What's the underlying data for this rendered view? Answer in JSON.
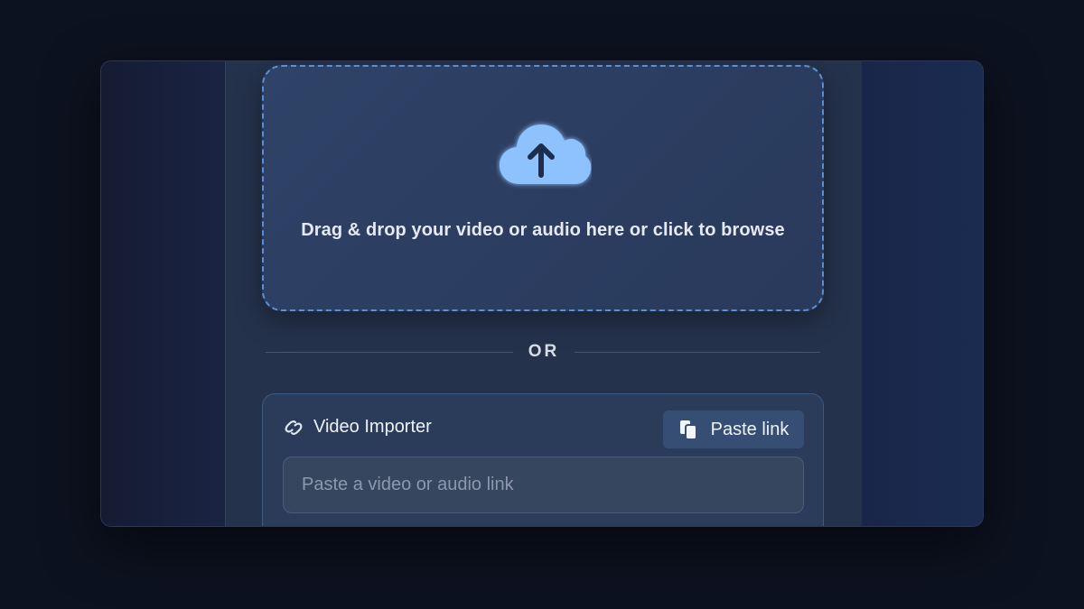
{
  "dropzone": {
    "icon": "cloud-upload-icon",
    "text": "Drag & drop your video or audio here or click to browse",
    "accent": "#5c8fd0",
    "icon_color": "#8ec2ff"
  },
  "divider": {
    "label": "OR"
  },
  "importer": {
    "icon": "link-icon",
    "title": "Video Importer",
    "paste_button": {
      "icon": "clipboard-icon",
      "label": "Paste link"
    },
    "input": {
      "value": "",
      "placeholder": "Paste a video or audio link"
    }
  }
}
